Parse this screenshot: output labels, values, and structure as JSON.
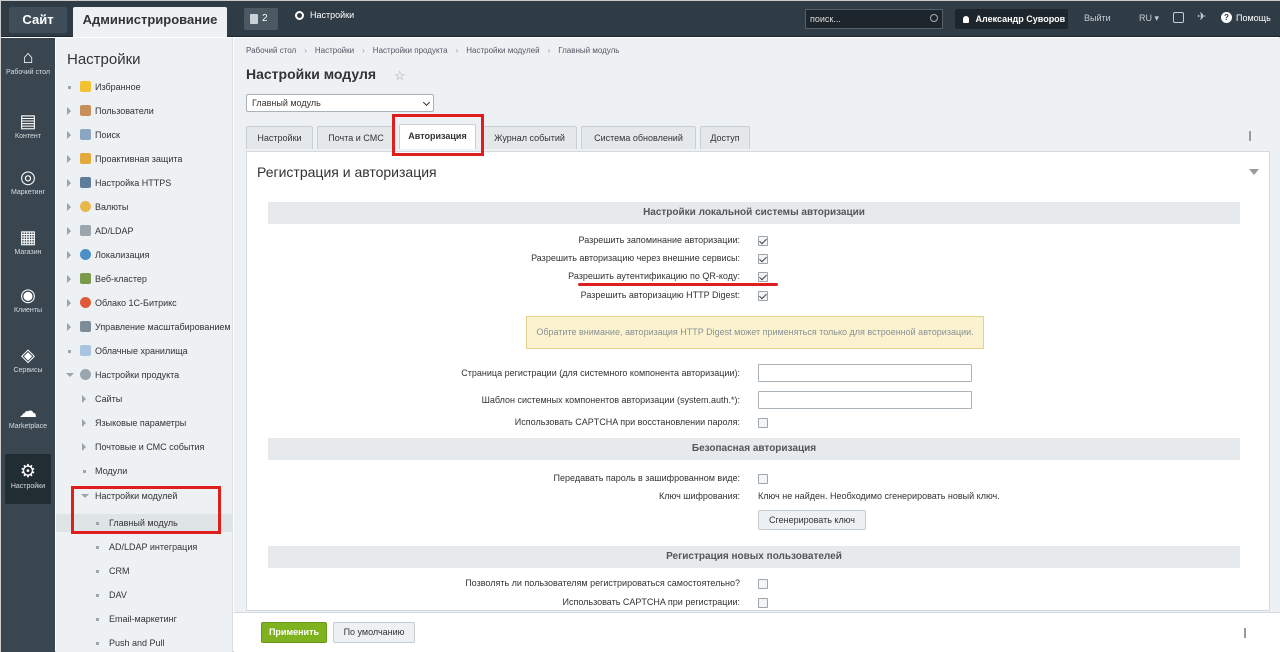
{
  "topbar": {
    "site": "Сайт",
    "admin": "Администрирование",
    "notifications": "2",
    "settings": "Настройки",
    "search_placeholder": "поиск...",
    "user": "Александр Суворов",
    "logout": "Выйти",
    "lang": "RU",
    "help": "Помощь"
  },
  "iconbar": [
    {
      "label": "Рабочий стол",
      "icon": "home-icon"
    },
    {
      "label": "Контент",
      "icon": "document-icon"
    },
    {
      "label": "Маркетинг",
      "icon": "target-icon"
    },
    {
      "label": "Магазин",
      "icon": "basket-icon"
    },
    {
      "label": "Клиенты",
      "icon": "clients-icon"
    },
    {
      "label": "Сервисы",
      "icon": "layers-icon"
    },
    {
      "label": "Marketplace",
      "icon": "cloud-icon"
    },
    {
      "label": "Настройки",
      "icon": "gear-icon"
    }
  ],
  "sidebar": {
    "title": "Настройки",
    "items": [
      {
        "label": "Избранное"
      },
      {
        "label": "Пользователи"
      },
      {
        "label": "Поиск"
      },
      {
        "label": "Проактивная защита"
      },
      {
        "label": "Настройка HTTPS"
      },
      {
        "label": "Валюты"
      },
      {
        "label": "AD/LDAP"
      },
      {
        "label": "Локализация"
      },
      {
        "label": "Веб-кластер"
      },
      {
        "label": "Облако 1С-Битрикс"
      },
      {
        "label": "Управление масштабированием"
      },
      {
        "label": "Облачные хранилища"
      },
      {
        "label": "Настройки продукта"
      },
      {
        "label": "Сайты"
      },
      {
        "label": "Языковые параметры"
      },
      {
        "label": "Почтовые и СМС события"
      },
      {
        "label": "Модули"
      },
      {
        "label": "Настройки модулей"
      },
      {
        "label": "Главный модуль"
      },
      {
        "label": "AD/LDAP интеграция"
      },
      {
        "label": "CRM"
      },
      {
        "label": "DAV"
      },
      {
        "label": "Email-маркетинг"
      },
      {
        "label": "Push and Pull"
      }
    ]
  },
  "breadcrumb": [
    "Рабочий стол",
    "Настройки",
    "Настройки продукта",
    "Настройки модулей",
    "Главный модуль"
  ],
  "page_title": "Настройки модуля",
  "module_select": "Главный модуль",
  "tabs": [
    "Настройки",
    "Почта и СМС",
    "Авторизация",
    "Журнал событий",
    "Система обновлений",
    "Доступ"
  ],
  "panel": {
    "title": "Регистрация и авторизация",
    "sections": [
      "Настройки локальной системы авторизации",
      "Безопасная авторизация",
      "Регистрация новых пользователей"
    ],
    "rows": {
      "remember": "Разрешить запоминание авторизации:",
      "external": "Разрешить авторизацию через внешние сервисы:",
      "qr": "Разрешить аутентификацию по QR-коду:",
      "digest": "Разрешить авторизацию HTTP Digest:",
      "reg_page": "Страница регистрации (для системного компонента авторизации):",
      "template": "Шаблон системных компонентов авторизации (system.auth.*):",
      "captcha_restore": "Использовать CAPTCHA при восстановлении пароля:",
      "encrypted": "Передавать пароль в зашифрованном виде:",
      "key_label": "Ключ шифрования:",
      "self_reg": "Позволять ли пользователям регистрироваться самостоятельно?",
      "captcha_reg": "Использовать CAPTCHA при регистрации:"
    },
    "note": "Обратите внимание, авторизация HTTP Digest может применяться только для встроенной авторизации.",
    "key_text": "Ключ не найден. Необходимо сгенерировать новый ключ.",
    "generate_button": "Сгенерировать ключ"
  },
  "footer": {
    "apply": "Применить",
    "default": "По умолчанию"
  },
  "colors": {
    "topbar": "#2f3c46",
    "iconbar": "#394650",
    "apply": "#7fb21f",
    "highlight": "#e01e1e"
  }
}
